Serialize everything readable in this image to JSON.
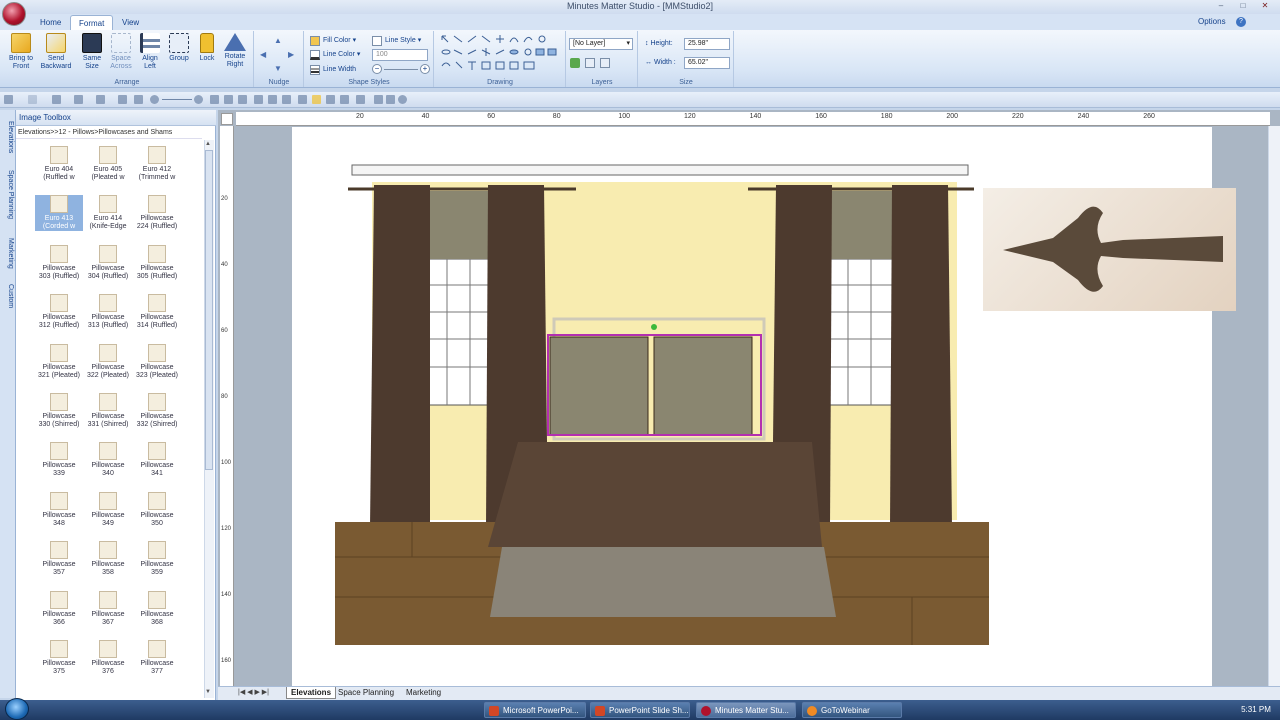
{
  "window": {
    "title": "Minutes Matter Studio - [MMStudio2]",
    "min": "–",
    "max": "□",
    "close": "✕"
  },
  "ribbon_tabs": [
    "Home",
    "Format",
    "View"
  ],
  "options_label": "Options",
  "help_icon": "?",
  "arrange": {
    "label": "Arrange",
    "buttons": [
      {
        "label1": "Bring to",
        "label2": "Front"
      },
      {
        "label1": "Send",
        "label2": "Backward"
      },
      {
        "label1": "Same",
        "label2": "Size"
      },
      {
        "label1": "Space",
        "label2": "Across"
      },
      {
        "label1": "Align",
        "label2": "Left"
      },
      {
        "label1": "Group",
        "label2": ""
      },
      {
        "label1": "Lock",
        "label2": ""
      },
      {
        "label1": "Rotate",
        "label2": "Right"
      }
    ]
  },
  "nudge": {
    "label": "Nudge"
  },
  "shape_styles": {
    "label": "Shape Styles",
    "fill_color": "Fill Color",
    "line_style": "Line Style",
    "line_color": "Line Color",
    "line_color_value": "100",
    "line_width": "Line Width"
  },
  "drawing": {
    "label": "Drawing"
  },
  "layers": {
    "label": "Layers",
    "value": "[No Layer]"
  },
  "size": {
    "label": "Size",
    "height_label": "Height:",
    "height_value": "25.98\"",
    "width_label": "Width :",
    "width_value": "65.02\""
  },
  "sidebar_tabs": [
    "Elevations",
    "Space Planning",
    "Marketing",
    "Custom"
  ],
  "toolbox": {
    "title": "Image Toolbox",
    "path": "Elevations>>12 - Pillows>Pillowcases and Shams",
    "items": [
      {
        "l1": "Euro 404",
        "l2": "(Ruffled w"
      },
      {
        "l1": "Euro 405",
        "l2": "(Pleated w"
      },
      {
        "l1": "Euro 412",
        "l2": "(Trimmed w"
      },
      {
        "l1": "Euro 413",
        "l2": "(Corded w"
      },
      {
        "l1": "Euro 414",
        "l2": "(Knife-Edge"
      },
      {
        "l1": "Pillowcase",
        "l2": "224 (Ruffled)"
      },
      {
        "l1": "Pillowcase",
        "l2": "303 (Ruffled)"
      },
      {
        "l1": "Pillowcase",
        "l2": "304 (Ruffled)"
      },
      {
        "l1": "Pillowcase",
        "l2": "305 (Ruffled)"
      },
      {
        "l1": "Pillowcase",
        "l2": "312 (Ruffled)"
      },
      {
        "l1": "Pillowcase",
        "l2": "313 (Ruffled)"
      },
      {
        "l1": "Pillowcase",
        "l2": "314 (Ruffled)"
      },
      {
        "l1": "Pillowcase",
        "l2": "321 (Pleated)"
      },
      {
        "l1": "Pillowcase",
        "l2": "322 (Pleated)"
      },
      {
        "l1": "Pillowcase",
        "l2": "323 (Pleated)"
      },
      {
        "l1": "Pillowcase",
        "l2": "330 (Shirred)"
      },
      {
        "l1": "Pillowcase",
        "l2": "331 (Shirred)"
      },
      {
        "l1": "Pillowcase",
        "l2": "332 (Shirred)"
      },
      {
        "l1": "Pillowcase",
        "l2": "339"
      },
      {
        "l1": "Pillowcase",
        "l2": "340"
      },
      {
        "l1": "Pillowcase",
        "l2": "341"
      },
      {
        "l1": "Pillowcase",
        "l2": "348"
      },
      {
        "l1": "Pillowcase",
        "l2": "349"
      },
      {
        "l1": "Pillowcase",
        "l2": "350"
      },
      {
        "l1": "Pillowcase",
        "l2": "357"
      },
      {
        "l1": "Pillowcase",
        "l2": "358"
      },
      {
        "l1": "Pillowcase",
        "l2": "359"
      },
      {
        "l1": "Pillowcase",
        "l2": "366"
      },
      {
        "l1": "Pillowcase",
        "l2": "367"
      },
      {
        "l1": "Pillowcase",
        "l2": "368"
      },
      {
        "l1": "Pillowcase",
        "l2": "375"
      },
      {
        "l1": "Pillowcase",
        "l2": "376"
      },
      {
        "l1": "Pillowcase",
        "l2": "377"
      }
    ]
  },
  "ruler_h": [
    "20",
    "40",
    "60",
    "80",
    "100",
    "120",
    "140",
    "160",
    "180",
    "200",
    "220",
    "240",
    "260"
  ],
  "ruler_v": [
    "20",
    "40",
    "60",
    "80",
    "100",
    "120",
    "140",
    "160"
  ],
  "sheet_tabs": [
    "Elevations",
    "Space Planning",
    "Marketing"
  ],
  "taskbar": {
    "tasks": [
      "Microsoft PowerPoi...",
      "PowerPoint Slide Sh...",
      "Minutes Matter Stu...",
      "GoToWebinar"
    ],
    "time": "5:31 PM"
  },
  "colors": {
    "wall": "#f8ecb0",
    "floor": "#7a5a32",
    "drape": "#4d3a2e",
    "selection": "#b42fb0"
  }
}
